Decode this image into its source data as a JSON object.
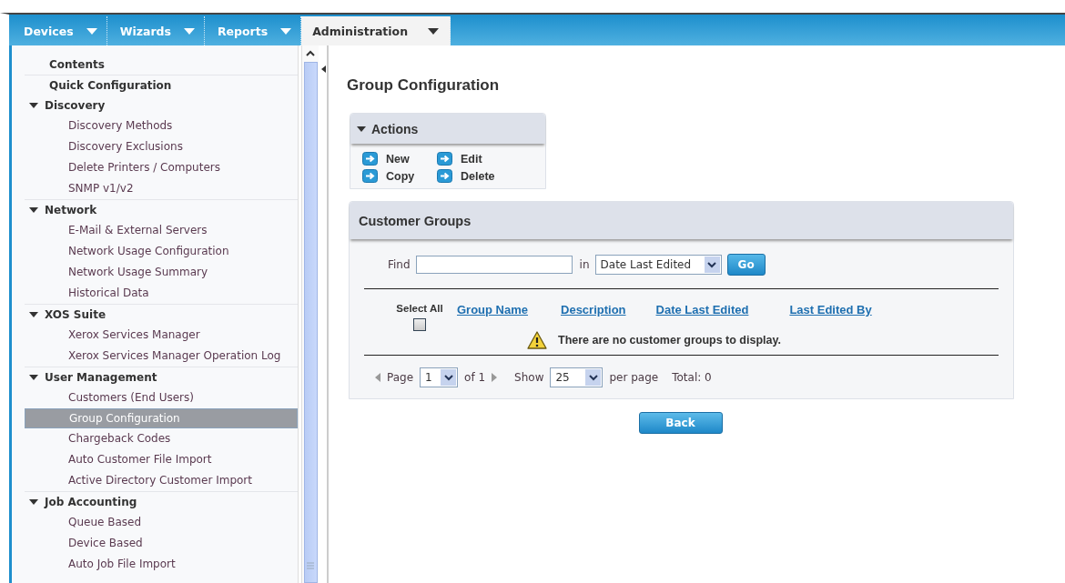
{
  "nav_tabs": [
    {
      "label": "Devices",
      "selected": false
    },
    {
      "label": "Wizards",
      "selected": false
    },
    {
      "label": "Reports",
      "selected": false
    },
    {
      "label": "Administration",
      "selected": true
    }
  ],
  "sidebar": {
    "items": [
      {
        "label": "Contents",
        "selected": false
      },
      {
        "label": "Quick Configuration",
        "selected": false
      },
      {
        "label": "Discovery",
        "expanded": true,
        "selected": false,
        "children": [
          {
            "label": "Discovery Methods",
            "selected": false
          },
          {
            "label": "Discovery Exclusions",
            "selected": false
          },
          {
            "label": "Delete Printers / Computers",
            "selected": false
          },
          {
            "label": "SNMP v1/v2",
            "selected": false
          }
        ]
      },
      {
        "label": "Network",
        "expanded": true,
        "selected": false,
        "children": [
          {
            "label": "E-Mail & External Servers",
            "selected": false
          },
          {
            "label": "Network Usage Configuration",
            "selected": false
          },
          {
            "label": "Network Usage Summary",
            "selected": false
          },
          {
            "label": "Historical Data",
            "selected": false
          }
        ]
      },
      {
        "label": "XOS Suite",
        "expanded": true,
        "selected": false,
        "children": [
          {
            "label": "Xerox Services Manager",
            "selected": false
          },
          {
            "label": "Xerox Services Manager Operation Log",
            "selected": false
          }
        ]
      },
      {
        "label": "User Management",
        "expanded": true,
        "selected": false,
        "children": [
          {
            "label": "Customers (End Users)",
            "selected": false
          },
          {
            "label": "Group Configuration",
            "selected": true
          },
          {
            "label": "Chargeback Codes",
            "selected": false
          },
          {
            "label": "Auto Customer File Import",
            "selected": false
          },
          {
            "label": "Active Directory Customer Import",
            "selected": false
          }
        ]
      },
      {
        "label": "Job Accounting",
        "expanded": true,
        "selected": false,
        "children": [
          {
            "label": "Queue Based",
            "selected": false
          },
          {
            "label": "Device Based",
            "selected": false
          },
          {
            "label": "Auto Job File Import",
            "selected": false
          }
        ]
      }
    ]
  },
  "page_title": "Group Configuration",
  "actions": {
    "title": "Actions",
    "expanded": true,
    "items": [
      "New",
      "Edit",
      "Copy",
      "Delete"
    ]
  },
  "customer_groups": {
    "title": "Customer Groups",
    "find_label": "Find",
    "in_label": "in",
    "in_select": "Date Last Edited",
    "go_button": "Go",
    "select_all": {
      "label": "Select All",
      "checked": false
    },
    "columns": [
      "Group Name",
      "Description",
      "Date Last Edited",
      "Last Edited By"
    ],
    "empty_message": "There are no customer groups to display.",
    "pager": {
      "page_label": "Page",
      "page_value": "1",
      "of_label": "of 1",
      "show_label": "Show",
      "show_value": "25",
      "per_page_label": "per page",
      "total": "Total: 0"
    }
  },
  "back_button": "Back"
}
